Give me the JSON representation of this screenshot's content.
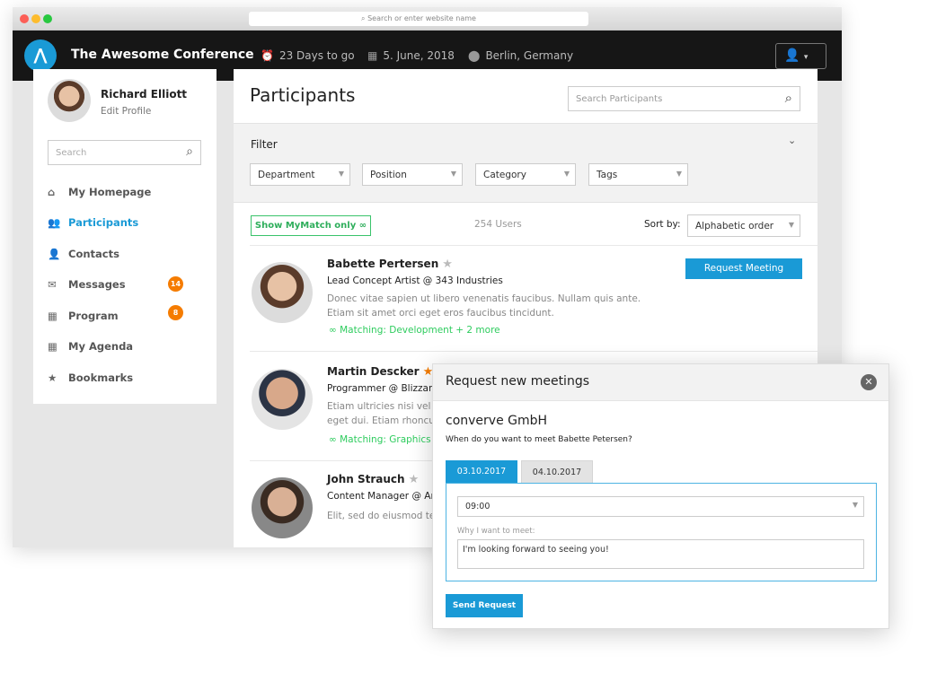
{
  "browser": {
    "url_placeholder": "Search or enter website name"
  },
  "header": {
    "title": "The Awesome Conference",
    "countdown": "23 Days to go",
    "date": "5.  June, 2018",
    "location": "Berlin, Germany",
    "user_icon": "user-icon"
  },
  "sidebar": {
    "user_name": "Richard Elliott",
    "edit_profile": "Edit Profile",
    "search_placeholder": "Search",
    "items": [
      {
        "label": "My Homepage",
        "icon": "home-icon"
      },
      {
        "label": "Participants",
        "icon": "users-icon",
        "active": true
      },
      {
        "label": "Contacts",
        "icon": "user-icon"
      },
      {
        "label": "Messages",
        "icon": "envelope-icon",
        "badge": "14"
      },
      {
        "label": "Program",
        "icon": "calendar-icon",
        "badge": "8"
      },
      {
        "label": "My Agenda",
        "icon": "agenda-icon"
      },
      {
        "label": "Bookmarks",
        "icon": "star-icon"
      }
    ]
  },
  "main": {
    "title": "Participants",
    "search_placeholder": "Search Participants",
    "filter_label": "Filter",
    "filters": [
      "Department",
      "Position",
      "Category",
      "Tags"
    ],
    "mymatch_label": "Show MyMatch only",
    "users_count": "254 Users",
    "sort_label": "Sort by:",
    "sort_value": "Alphabetic order",
    "request_button": "Request Meeting",
    "participants": [
      {
        "name": "Babette Pertersen",
        "starred": false,
        "role": "Lead Concept Artist @ 343 Industries",
        "desc": "Donec vitae sapien ut libero venenatis faucibus. Nullam quis ante. Etiam sit amet orci eget eros faucibus tincidunt.",
        "matching": "Matching: Development + 2 more"
      },
      {
        "name": "Martin Descker",
        "starred": true,
        "role": "Programmer @  Blizzard",
        "desc": "Etiam ultricies nisi vel a",
        "desc2": "eget dui. Etiam rhoncus.",
        "matching": "Matching: Graphics"
      },
      {
        "name": "John Strauch",
        "starred": false,
        "role": "Content Manager @ Arvo",
        "desc": "Elit, sed do eiusmod tem"
      }
    ]
  },
  "modal": {
    "title": "Request new meetings",
    "company": "converve GmbH",
    "question": "When do you want to meet Babette Petersen?",
    "tabs": [
      "03.10.2017",
      "04.10.2017"
    ],
    "time_value": "09:00",
    "reason_label": "Why I want to meet:",
    "reason_value": "I'm looking forward to seeing you!",
    "send_label": "Send Request"
  },
  "colors": {
    "accent": "#1a9ad6",
    "match_green": "#2ecc5e",
    "badge": "#f57c00",
    "star_active": "#f57c00"
  }
}
